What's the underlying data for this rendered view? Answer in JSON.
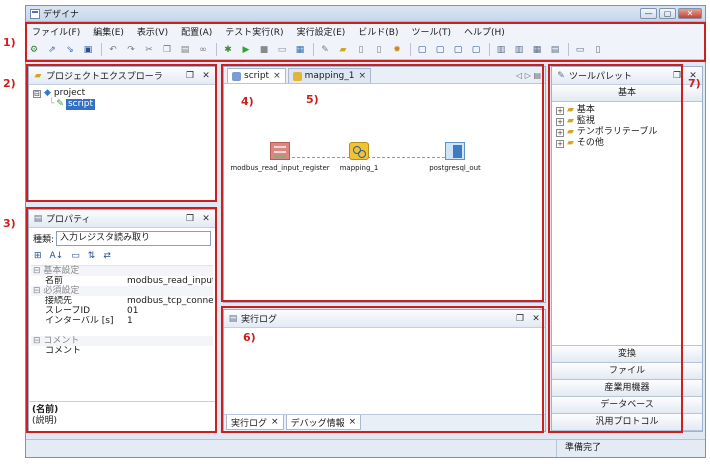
{
  "callouts": [
    "1)",
    "2)",
    "3)",
    "4)",
    "5)",
    "6)",
    "7)"
  ],
  "window": {
    "title": "デザイナ"
  },
  "menu": [
    "ファイル(F)",
    "編集(E)",
    "表示(V)",
    "配置(A)",
    "テスト実行(R)",
    "実行設定(E)",
    "ビルド(B)",
    "ツール(T)",
    "ヘルプ(H)"
  ],
  "toolbar": [
    {
      "icon": "settings-icon",
      "glyph": "⚙",
      "color": "#2f7a34"
    },
    {
      "icon": "export-icon",
      "glyph": "⇗",
      "color": "#2e6fb0"
    },
    {
      "icon": "import-icon",
      "glyph": "⇘",
      "color": "#2e6fb0"
    },
    {
      "icon": "save-icon",
      "glyph": "▣",
      "color": "#2b4f8a"
    },
    {
      "icon": "undo-icon",
      "glyph": "↶",
      "color": "#7a7a7a"
    },
    {
      "icon": "redo-icon",
      "glyph": "↷",
      "color": "#7a7a7a"
    },
    {
      "icon": "cut-icon",
      "glyph": "✂",
      "color": "#7a7a7a"
    },
    {
      "icon": "copy-icon",
      "glyph": "❐",
      "color": "#7a7a7a"
    },
    {
      "icon": "paste-icon",
      "glyph": "▤",
      "color": "#7a7a7a"
    },
    {
      "icon": "link-icon",
      "glyph": "∞",
      "color": "#7a7a7a"
    },
    {
      "icon": "debug-icon",
      "glyph": "✱",
      "color": "#3c8a3c"
    },
    {
      "icon": "run-icon",
      "glyph": "▶",
      "color": "#2fa336"
    },
    {
      "icon": "stop-icon",
      "glyph": "■",
      "color": "#8a8a8a"
    },
    {
      "icon": "console-icon",
      "glyph": "▭",
      "color": "#8a8a8a"
    },
    {
      "icon": "deploy-icon",
      "glyph": "▦",
      "color": "#2e6fb0"
    },
    {
      "icon": "tools-icon",
      "glyph": "✎",
      "color": "#7a7a7a"
    },
    {
      "icon": "folder-icon",
      "glyph": "▰",
      "color": "#d6a520"
    },
    {
      "icon": "page-icon",
      "glyph": "▯",
      "color": "#7a7a7a"
    },
    {
      "icon": "doc-icon",
      "glyph": "▯",
      "color": "#7a7a7a"
    },
    {
      "icon": "bug-icon",
      "glyph": "✹",
      "color": "#cc8a1d"
    },
    {
      "icon": "align-left-icon",
      "glyph": "▢",
      "color": "#2b4f8a"
    },
    {
      "icon": "align-center-icon",
      "glyph": "▢",
      "color": "#2b4f8a"
    },
    {
      "icon": "align-right-icon",
      "glyph": "▢",
      "color": "#2b4f8a"
    },
    {
      "icon": "align-top-icon",
      "glyph": "▢",
      "color": "#2b4f8a"
    },
    {
      "icon": "distribute-h-icon",
      "glyph": "▥",
      "color": "#5a6c88"
    },
    {
      "icon": "distribute-v-icon",
      "glyph": "▥",
      "color": "#5a6c88"
    },
    {
      "icon": "grid-icon",
      "glyph": "▦",
      "color": "#5a6c88"
    },
    {
      "icon": "zoom-icon",
      "glyph": "▤",
      "color": "#5a6c88"
    },
    {
      "icon": "layout-h-icon",
      "glyph": "▭",
      "color": "#5a6c88"
    },
    {
      "icon": "layout-v-icon",
      "glyph": "▯",
      "color": "#5a6c88"
    }
  ],
  "explorer": {
    "title": "プロジェクトエクスプローラ",
    "tree": [
      {
        "label": "project",
        "expander": "⊟"
      },
      {
        "label": "script",
        "selected": true
      }
    ]
  },
  "properties": {
    "title": "プロパティ",
    "type_label": "種類:",
    "type_value": "入力レジスタ読み取り",
    "tools": [
      "⊞",
      "A↓",
      "▭",
      "⇅",
      "⇄"
    ],
    "rows": [
      {
        "kind": "cat",
        "key": "⊟ 基本設定"
      },
      {
        "kind": "row",
        "key": "名前",
        "value": "modbus_read_input..."
      },
      {
        "kind": "cat",
        "key": "⊟ 必須設定"
      },
      {
        "kind": "row",
        "key": "接続先",
        "value": "modbus_tcp_connec..."
      },
      {
        "kind": "row",
        "key": "スレーブID",
        "value": "01"
      },
      {
        "kind": "row",
        "key": "インターバル [s]",
        "value": "1"
      },
      {
        "kind": "blank"
      },
      {
        "kind": "cat",
        "key": "⊟ コメント"
      },
      {
        "kind": "row",
        "key": "コメント",
        "value": ""
      }
    ],
    "desc_name": "(名前)",
    "desc_text": "(説明)"
  },
  "editor": {
    "tabs": [
      {
        "label": "script",
        "active": true,
        "color": "#7a9ed1"
      },
      {
        "label": "mapping_1",
        "active": false,
        "color": "#e4b43a"
      }
    ],
    "nav": "◁ ▷ ▤",
    "nodes": [
      {
        "label": "modbus_read_input_register",
        "icon": "modbus-node-icon"
      },
      {
        "label": "mapping_1",
        "icon": "mapping-node-icon"
      },
      {
        "label": "postgresql_out",
        "icon": "postgresql-node-icon"
      }
    ]
  },
  "log": {
    "title": "実行ログ",
    "tabs": [
      "実行ログ",
      "デバッグ情報"
    ]
  },
  "palette": {
    "title": "ツールパレット",
    "active_category": "基本",
    "tree": [
      "基本",
      "監視",
      "テンポラリテーブル",
      "その他"
    ],
    "categories": [
      "変換",
      "ファイル",
      "産業用機器",
      "データベース",
      "汎用プロトコル"
    ]
  },
  "status": {
    "text": "準備完了"
  }
}
